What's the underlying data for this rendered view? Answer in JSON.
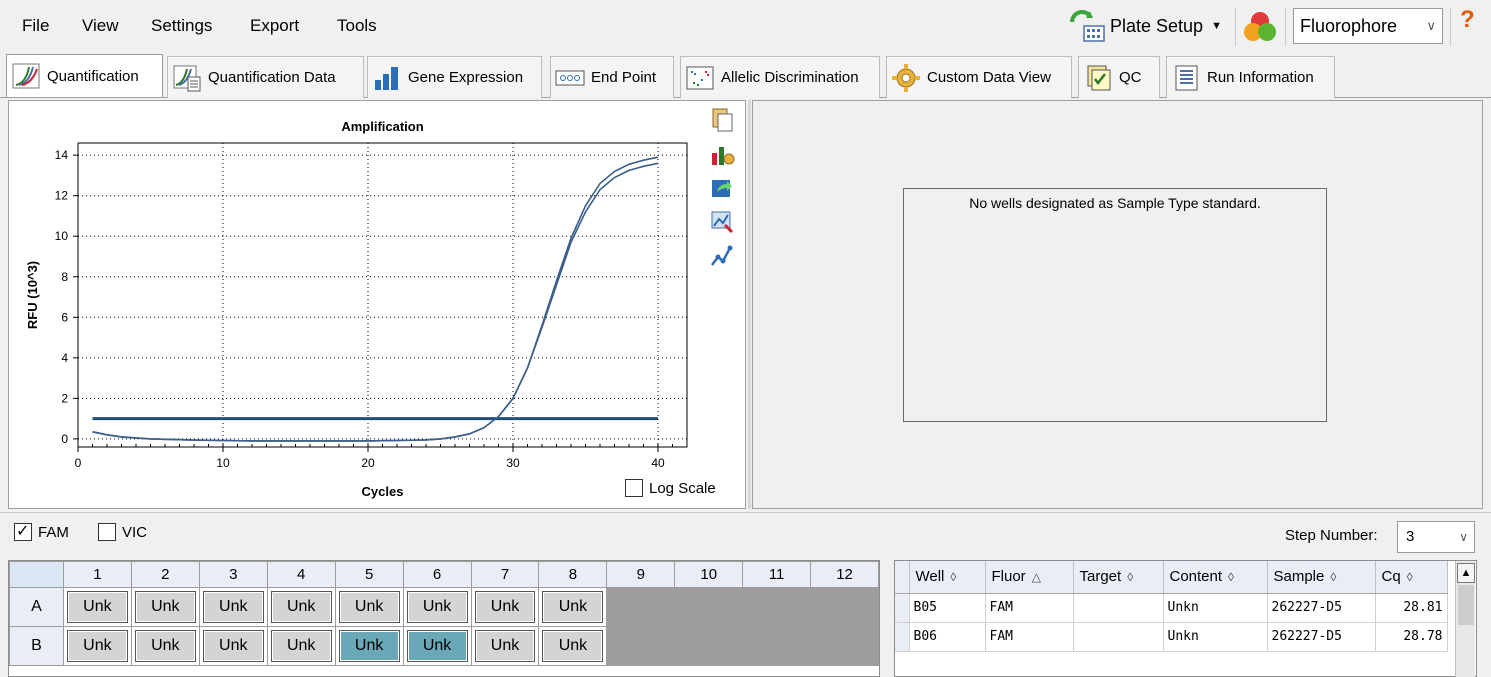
{
  "menu": {
    "items": [
      {
        "label": "File"
      },
      {
        "label": "View"
      },
      {
        "label": "Settings"
      },
      {
        "label": "Export"
      },
      {
        "label": "Tools"
      }
    ],
    "plate_setup_label": "Plate Setup",
    "fluorophore_value": "Fluorophore",
    "help_label": "?"
  },
  "tabs": [
    {
      "label": "Quantification",
      "active": true
    },
    {
      "label": "Quantification Data"
    },
    {
      "label": "Gene Expression"
    },
    {
      "label": "End Point"
    },
    {
      "label": "Allelic Discrimination"
    },
    {
      "label": "Custom Data View"
    },
    {
      "label": "QC"
    },
    {
      "label": "Run Information"
    }
  ],
  "chart": {
    "log_scale_label": "Log Scale",
    "log_scale_checked": false
  },
  "chart_data": {
    "type": "line",
    "title": "Amplification",
    "xlabel": "Cycles",
    "ylabel": "RFU (10^3)",
    "xlim": [
      0,
      42
    ],
    "ylim": [
      -0.4,
      14.6
    ],
    "xticks": [
      0,
      10,
      20,
      30,
      40
    ],
    "yticks": [
      0,
      2,
      4,
      6,
      8,
      10,
      12,
      14
    ],
    "grid": "dotted",
    "threshold": {
      "y": 1.0,
      "x_range": [
        1,
        40
      ]
    },
    "series": [
      {
        "x": [
          1,
          2,
          3,
          4,
          5,
          6,
          8,
          10,
          12,
          14,
          16,
          18,
          20,
          22,
          24,
          25,
          26,
          27,
          28,
          29,
          30,
          31,
          32,
          33,
          34,
          35,
          36,
          37,
          38,
          39,
          40
        ],
        "y": [
          0.35,
          0.2,
          0.1,
          0.05,
          0.0,
          -0.02,
          -0.06,
          -0.08,
          -0.1,
          -0.1,
          -0.1,
          -0.1,
          -0.1,
          -0.08,
          -0.05,
          0.0,
          0.1,
          0.25,
          0.55,
          1.1,
          2.0,
          3.5,
          5.6,
          7.8,
          9.9,
          11.5,
          12.6,
          13.2,
          13.55,
          13.75,
          13.9
        ]
      },
      {
        "x": [
          1,
          2,
          3,
          4,
          5,
          6,
          8,
          10,
          12,
          14,
          16,
          18,
          20,
          22,
          24,
          25,
          26,
          27,
          28,
          29,
          30,
          31,
          32,
          33,
          34,
          35,
          36,
          37,
          38,
          39,
          40
        ],
        "y": [
          0.35,
          0.2,
          0.1,
          0.05,
          0.0,
          -0.02,
          -0.06,
          -0.08,
          -0.1,
          -0.1,
          -0.1,
          -0.1,
          -0.1,
          -0.08,
          -0.05,
          0.0,
          0.1,
          0.25,
          0.55,
          1.1,
          2.0,
          3.5,
          5.5,
          7.6,
          9.7,
          11.2,
          12.3,
          12.9,
          13.25,
          13.45,
          13.6
        ]
      }
    ]
  },
  "standard": {
    "message": "No wells designated as Sample Type standard."
  },
  "filters": {
    "fam_label": "FAM",
    "fam_checked": true,
    "vic_label": "VIC",
    "vic_checked": false,
    "step_label": "Step Number:",
    "step_value": "3"
  },
  "plate": {
    "columns": [
      "1",
      "2",
      "3",
      "4",
      "5",
      "6",
      "7",
      "8",
      "9",
      "10",
      "11",
      "12"
    ],
    "rows": [
      {
        "label": "A",
        "cells": [
          "Unk",
          "Unk",
          "Unk",
          "Unk",
          "Unk",
          "Unk",
          "Unk",
          "Unk",
          "",
          "",
          "",
          ""
        ],
        "selected": [
          false,
          false,
          false,
          false,
          false,
          false,
          false,
          false
        ]
      },
      {
        "label": "B",
        "cells": [
          "Unk",
          "Unk",
          "Unk",
          "Unk",
          "Unk",
          "Unk",
          "Unk",
          "Unk",
          "",
          "",
          "",
          ""
        ],
        "selected": [
          false,
          false,
          false,
          false,
          true,
          true,
          false,
          false
        ]
      }
    ]
  },
  "results": {
    "headers": [
      {
        "label": "Well",
        "sort": "◊"
      },
      {
        "label": "Fluor",
        "sort": "△"
      },
      {
        "label": "Target",
        "sort": "◊"
      },
      {
        "label": "Content",
        "sort": "◊"
      },
      {
        "label": "Sample",
        "sort": "◊"
      },
      {
        "label": "Cq",
        "sort": "◊"
      }
    ],
    "rows": [
      [
        "B05",
        "FAM",
        "",
        "Unkn",
        "262227-D5",
        "28.81"
      ],
      [
        "B06",
        "FAM",
        "",
        "Unkn",
        "262227-D5",
        "28.78"
      ]
    ]
  },
  "colors": {
    "curve": "#3b5f8a",
    "threshold": "#1f4e79",
    "selected_well": "#6aa8b8",
    "empty_well": "#9e9e9e"
  }
}
